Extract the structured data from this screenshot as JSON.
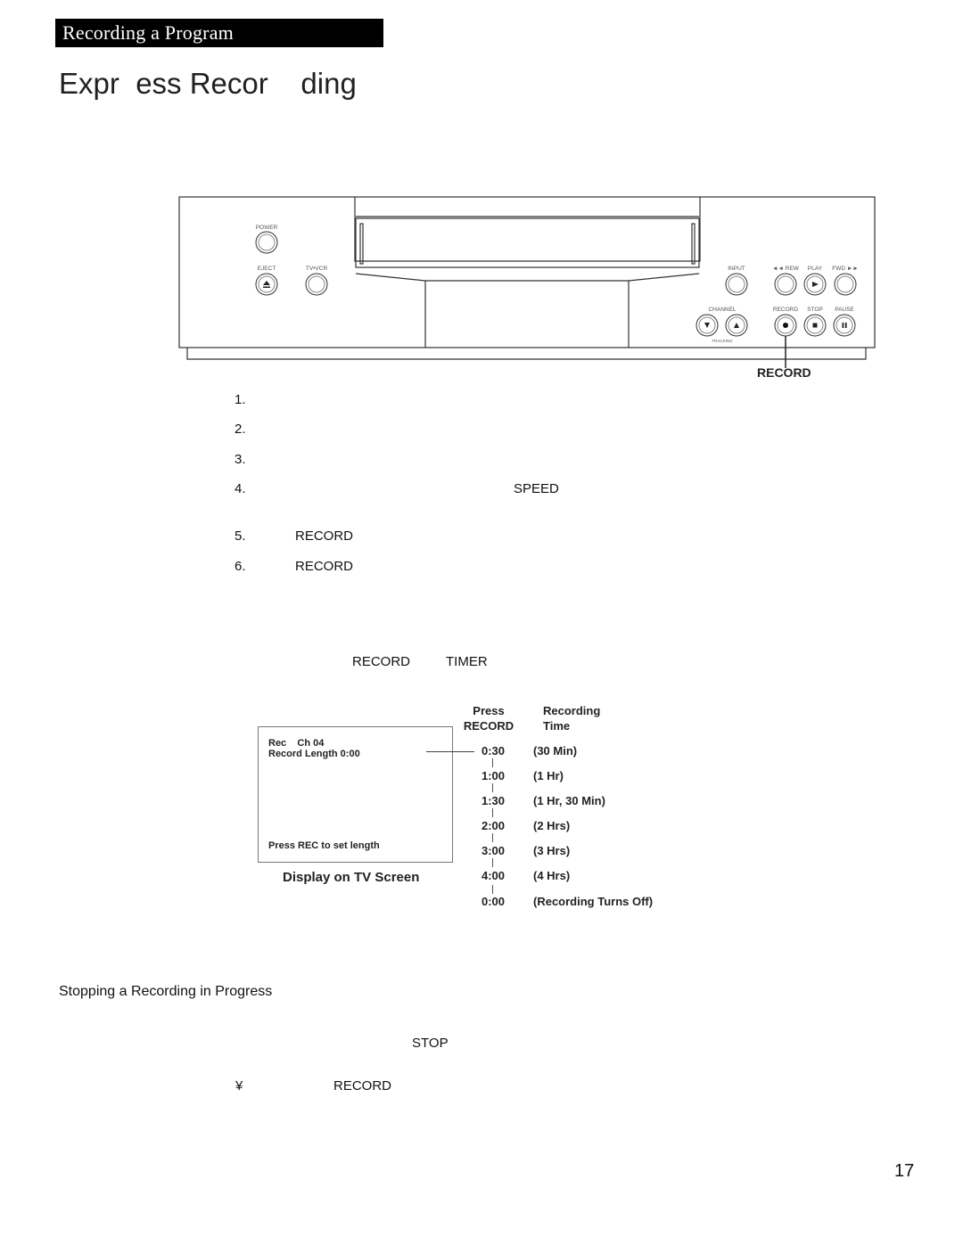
{
  "header": {
    "section_label": "Recording a Program"
  },
  "page_title": "Expr  ess Recor    ding",
  "vcr_panel": {
    "labels": {
      "power": "POWER",
      "eject": "EJECT",
      "tv_vcr": "TV•VCR",
      "input": "INPUT",
      "rew": "◄◄ REW",
      "play": "PLAY",
      "fwd": "FWD ►►",
      "channel": "CHANNEL",
      "tracking": "TRACKING",
      "record": "RECORD",
      "stop": "STOP",
      "pause": "PAUSE"
    },
    "icons": {
      "eject": "eject-icon",
      "play": "play-icon",
      "channel_down": "triangle-down-icon",
      "channel_up": "triangle-up-icon",
      "record": "record-dot-icon",
      "stop": "stop-square-icon",
      "pause": "pause-icon"
    },
    "callout": "RECORD"
  },
  "steps": [
    {
      "num": "1.",
      "keyword": ""
    },
    {
      "num": "2.",
      "keyword": ""
    },
    {
      "num": "3.",
      "keyword": ""
    },
    {
      "num": "4.",
      "keyword": "SPEED"
    },
    {
      "num": "5.",
      "keyword": "RECORD"
    },
    {
      "num": "6.",
      "keyword": "RECORD"
    }
  ],
  "note_keywords": {
    "first": "RECORD",
    "second": "TIMER"
  },
  "tv_screen": {
    "line1": "Rec    Ch 04",
    "line2": "Record Length 0:00",
    "footer": "Press REC to set length",
    "caption": "Display on TV Screen"
  },
  "timeline": {
    "col_press": [
      "Press",
      "RECORD"
    ],
    "col_time": [
      "Recording",
      "Time"
    ],
    "rows": [
      {
        "time": "0:30",
        "desc": "(30 Min)"
      },
      {
        "time": "1:00",
        "desc": "(1 Hr)"
      },
      {
        "time": "1:30",
        "desc": "(1 Hr, 30 Min)"
      },
      {
        "time": "2:00",
        "desc": "(2 Hrs)"
      },
      {
        "time": "3:00",
        "desc": "(3 Hrs)"
      },
      {
        "time": "4:00",
        "desc": "(4 Hrs)"
      },
      {
        "time": "0:00",
        "desc": "(Recording Turns Off)"
      }
    ]
  },
  "stopping": {
    "heading": "Stopping a Recording in Progress",
    "stop_keyword": "STOP",
    "bullet": "¥",
    "record_keyword": "RECORD"
  },
  "page_number": "17"
}
